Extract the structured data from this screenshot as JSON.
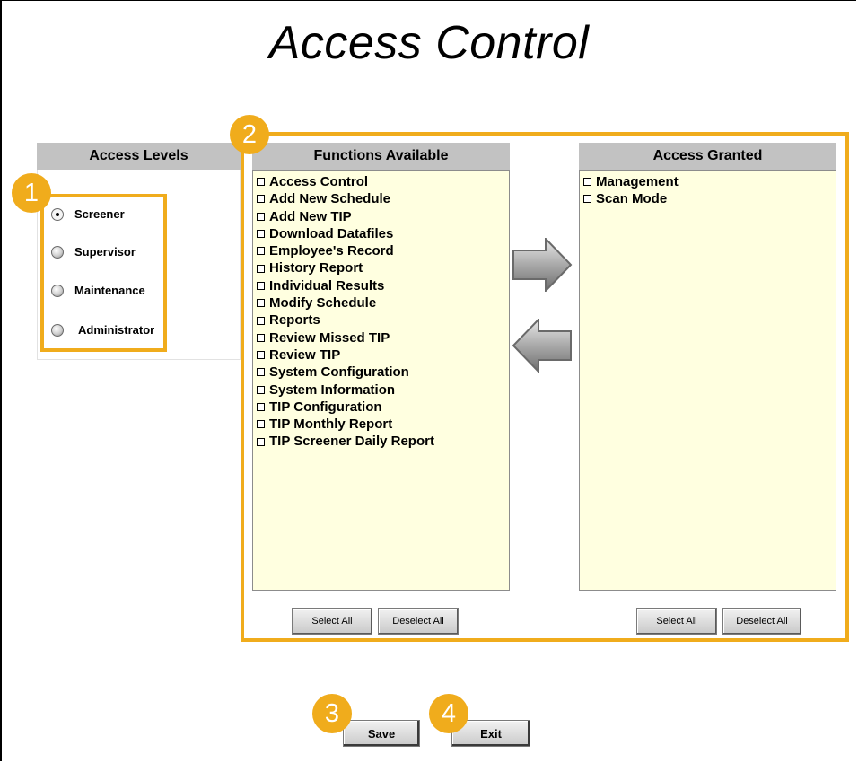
{
  "title": "Access Control",
  "access_levels": {
    "header": "Access Levels",
    "options": [
      {
        "label": "Screener",
        "selected": true
      },
      {
        "label": "Supervisor",
        "selected": false
      },
      {
        "label": "Maintenance",
        "selected": false
      },
      {
        "label": "Administrator",
        "selected": false
      }
    ]
  },
  "functions_available": {
    "header": "Functions Available",
    "items": [
      "Access Control",
      "Add New Schedule",
      "Add New TIP",
      "Download Datafiles",
      "Employee's Record",
      "History Report",
      "Individual Results",
      "Modify Schedule",
      "Reports",
      "Review Missed TIP",
      "Review TIP",
      "System Configuration",
      "System Information",
      "TIP Configuration",
      "TIP Monthly Report",
      "TIP Screener Daily Report"
    ],
    "select_all_label": "Select All",
    "deselect_all_label": "Deselect All"
  },
  "access_granted": {
    "header": "Access Granted",
    "items": [
      "Management",
      "Scan Mode"
    ],
    "select_all_label": "Select All",
    "deselect_all_label": "Deselect All"
  },
  "actions": {
    "save_label": "Save",
    "exit_label": "Exit"
  },
  "callouts": [
    "1",
    "2",
    "3",
    "4"
  ],
  "colors": {
    "callout": "#f0ac1c",
    "header": "#c2c2c2",
    "list_bg": "#ffffe0"
  },
  "icons": {
    "move_right": "arrow-right-icon",
    "move_left": "arrow-left-icon"
  }
}
